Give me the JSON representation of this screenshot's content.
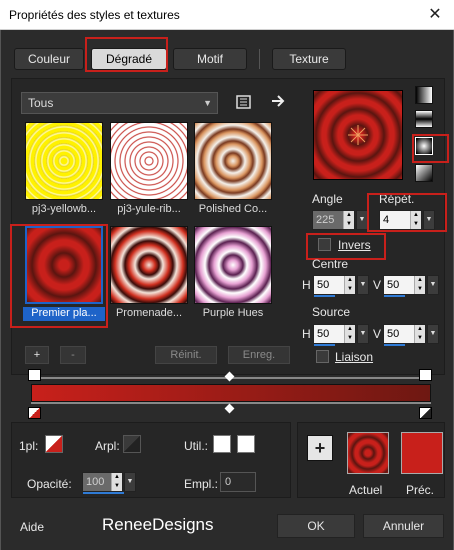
{
  "window": {
    "title": "Propriétés des styles et textures",
    "close_glyph": "✕"
  },
  "tabs": [
    {
      "label": "Couleur"
    },
    {
      "label": "Dégradé"
    },
    {
      "label": "Motif"
    },
    {
      "label": "Texture"
    }
  ],
  "library": {
    "category": "Tous",
    "items": [
      {
        "label": "pj3-yellowb..."
      },
      {
        "label": "pj3-yule-rib..."
      },
      {
        "label": "Polished Co..."
      },
      {
        "label": "Premier pla..."
      },
      {
        "label": "Promenade..."
      },
      {
        "label": "Purple Hues"
      }
    ]
  },
  "gradient": {
    "angle_label": "Angle",
    "angle_value": "225",
    "repeat_label": "Répét.",
    "repeat_value": "4",
    "invert_label": "Invers",
    "center_label": "Centre",
    "center_h": "50",
    "center_v": "50",
    "source_label": "Source",
    "source_h": "50",
    "source_v": "50",
    "link_label": "Liaison",
    "h_label": "H",
    "v_label": "V"
  },
  "editor": {
    "add": "+",
    "remove": "-",
    "reset": "Réinit.",
    "save": "Enreg."
  },
  "stops": {
    "first_label": "1pl:",
    "back_label": "Arpl:",
    "user_label": "Util.:",
    "opacity_label": "Opacité:",
    "opacity_value": "100",
    "location_label": "Empl.:",
    "location_value": "0"
  },
  "preview": {
    "current_label": "Actuel",
    "previous_label": "Préc.",
    "add": "+"
  },
  "footer": {
    "help": "Aide",
    "watermark": "ReneeDesigns",
    "ok": "OK",
    "cancel": "Annuler"
  },
  "colors": {
    "accent_red": "#c8201b",
    "selection_blue": "#1e63c8",
    "dark_red": "#6e1812"
  }
}
